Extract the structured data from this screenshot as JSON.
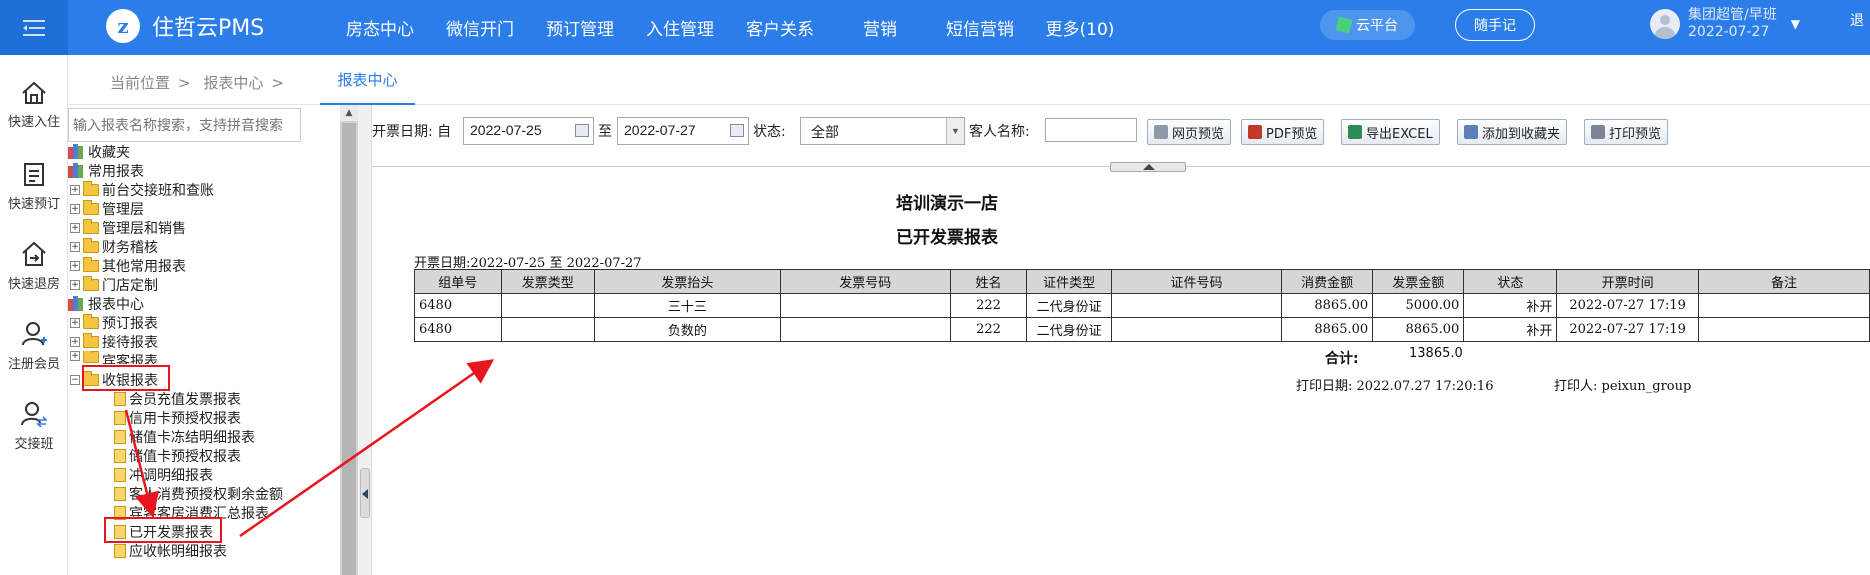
{
  "topbar": {
    "brand": "住哲云PMS",
    "nav": [
      "房态中心",
      "微信开门",
      "预订管理",
      "入住管理",
      "客户关系",
      "营销",
      "短信营销",
      "更多(10)"
    ],
    "cloud_label": "云平台",
    "note_label": "随手记",
    "user_name": "集团超管/早班",
    "user_date": "2022-07-27",
    "exit_partial": "退"
  },
  "sidebar_quick": [
    {
      "label": "快速入住",
      "icon": "home-icon"
    },
    {
      "label": "快速预订",
      "icon": "clipboard-icon"
    },
    {
      "label": "快速退房",
      "icon": "checkout-house-icon"
    },
    {
      "label": "注册会员",
      "icon": "user-add-icon"
    },
    {
      "label": "交接班",
      "icon": "user-switch-icon"
    }
  ],
  "breadcrumb": {
    "items": [
      "当前位置",
      "报表中心",
      ""
    ],
    "tab": "报表中心"
  },
  "tree": {
    "search_placeholder": "输入报表名称搜索，支持拼音搜索",
    "nodes": [
      {
        "label": "收藏夹",
        "kind": "root"
      },
      {
        "label": "常用报表",
        "kind": "root"
      },
      {
        "label": "前台交接班和查账",
        "kind": "folder"
      },
      {
        "label": "管理层",
        "kind": "folder"
      },
      {
        "label": "管理层和销售",
        "kind": "folder"
      },
      {
        "label": "财务稽核",
        "kind": "folder"
      },
      {
        "label": "其他常用报表",
        "kind": "folder"
      },
      {
        "label": "门店定制",
        "kind": "folder"
      },
      {
        "label": "报表中心",
        "kind": "root"
      },
      {
        "label": "预订报表",
        "kind": "folder"
      },
      {
        "label": "接待报表",
        "kind": "folder"
      },
      {
        "label": "宾客报表",
        "kind": "folder"
      },
      {
        "label": "收银报表",
        "kind": "open"
      },
      {
        "label": "会员充值发票报表",
        "kind": "leaf"
      },
      {
        "label": "信用卡预授权报表",
        "kind": "leaf"
      },
      {
        "label": "储值卡冻结明细报表",
        "kind": "leaf"
      },
      {
        "label": "储值卡预授权报表",
        "kind": "leaf"
      },
      {
        "label": "冲调明细报表",
        "kind": "leaf"
      },
      {
        "label": "客人消费预授权剩余金额",
        "kind": "leaf"
      },
      {
        "label": "宾客客房消费汇总报表",
        "kind": "leaf"
      },
      {
        "label": "已开发票报表",
        "kind": "leaf"
      },
      {
        "label": "应收帐明细报表",
        "kind": "leaf"
      }
    ]
  },
  "filters": {
    "date_label": "开票日期: 自",
    "date_from": "2022-07-25",
    "to_label": "至",
    "date_to": "2022-07-27",
    "status_label": "状态:",
    "status_value": "全部",
    "guest_label": "客人名称:",
    "guest_value": "",
    "buttons": [
      "网页预览",
      "PDF预览",
      "导出EXCEL",
      "添加到收藏夹",
      "打印预览"
    ]
  },
  "report": {
    "hotel": "培训演示一店",
    "title": "已开发票报表",
    "range": "开票日期:2022-07-25 至 2022-07-27",
    "columns": [
      "组单号",
      "发票类型",
      "发票抬头",
      "发票号码",
      "姓名",
      "证件类型",
      "证件号码",
      "消费金额",
      "发票金额",
      "状态",
      "开票时间",
      "备注"
    ],
    "rows": [
      [
        "6480",
        "",
        "三十三",
        "",
        "222",
        "二代身份证",
        "",
        "8865.00",
        "5000.00",
        "补开",
        "2022-07-27 17:19",
        ""
      ],
      [
        "6480",
        "",
        "负数的",
        "",
        "222",
        "二代身份证",
        "",
        "8865.00",
        "8865.00",
        "补开",
        "2022-07-27 17:19",
        ""
      ]
    ],
    "total_label": "合计:",
    "total_value": "13865.0",
    "print_date": "打印日期: 2022.07.27 17:20:16",
    "printer": "打印人: peixun_group"
  },
  "colors": {
    "brand": "#2b7de9",
    "highlight": "#e8141e"
  }
}
